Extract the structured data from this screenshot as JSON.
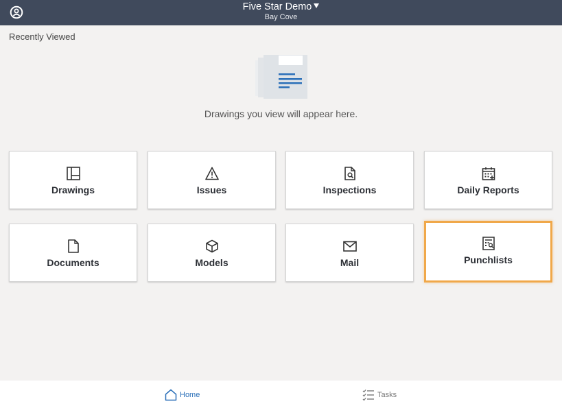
{
  "header": {
    "project_name": "Five Star Demo",
    "project_location": "Bay Cove",
    "profile_icon": "user-circle-icon"
  },
  "recently_viewed": {
    "label": "Recently Viewed",
    "empty_message": "Drawings you view will appear here."
  },
  "tools": [
    {
      "label": "Drawings",
      "icon": "drawings-icon"
    },
    {
      "label": "Issues",
      "icon": "warning-triangle-icon"
    },
    {
      "label": "Inspections",
      "icon": "document-search-icon"
    },
    {
      "label": "Daily Reports",
      "icon": "calendar-plus-icon"
    },
    {
      "label": "Documents",
      "icon": "document-icon"
    },
    {
      "label": "Models",
      "icon": "cube-icon"
    },
    {
      "label": "Mail",
      "icon": "mail-icon"
    },
    {
      "label": "Punchlists",
      "icon": "punchlist-icon",
      "highlighted": true
    }
  ],
  "colors": {
    "header_bg": "#404a5c",
    "highlight": "#f0a84a",
    "active_nav": "#2a6fb8"
  },
  "bottom_nav": {
    "home": "Home",
    "tasks": "Tasks"
  }
}
